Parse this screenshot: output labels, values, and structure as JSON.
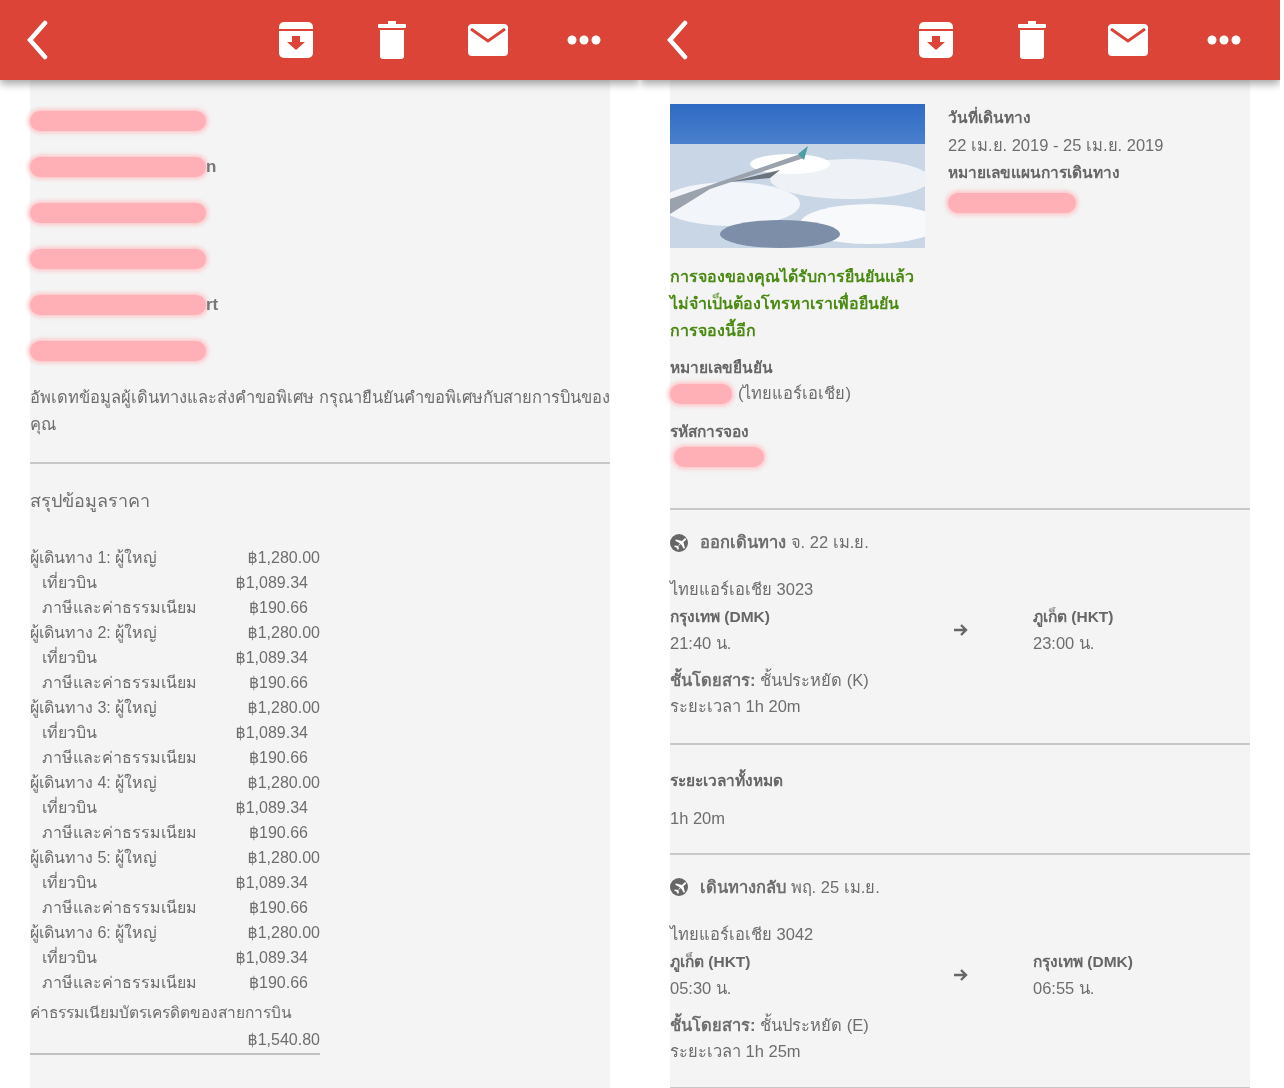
{
  "screens": [
    {
      "kind": "price",
      "names": [
        {
          "kind": "redacted"
        },
        {
          "kind": "redacted",
          "fragment": "n"
        },
        {
          "kind": "redacted"
        },
        {
          "kind": "redacted"
        },
        {
          "kind": "redacted",
          "fragment": "rt"
        },
        {
          "kind": "redacted"
        }
      ],
      "notice": "อัพเดทข้อมูลผู้เดินทางและส่งคำขอพิเศษ กรุณายืนยันคำขอพิเศษกับสายการบินของคุณ",
      "price_title": "สรุปข้อมูลราคา",
      "passengers": [
        {
          "label": "ผู้เดินทาง 1: ผู้ใหญ่",
          "total": "฿1,280.00",
          "items": [
            {
              "label": "เที่ยวบิน",
              "amount": "฿1,089.34"
            },
            {
              "label": "ภาษีและค่าธรรมเนียม",
              "amount": "฿190.66"
            }
          ]
        },
        {
          "label": "ผู้เดินทาง 2: ผู้ใหญ่",
          "total": "฿1,280.00",
          "items": [
            {
              "label": "เที่ยวบิน",
              "amount": "฿1,089.34"
            },
            {
              "label": "ภาษีและค่าธรรมเนียม",
              "amount": "฿190.66"
            }
          ]
        },
        {
          "label": "ผู้เดินทาง 3: ผู้ใหญ่",
          "total": "฿1,280.00",
          "items": [
            {
              "label": "เที่ยวบิน",
              "amount": "฿1,089.34"
            },
            {
              "label": "ภาษีและค่าธรรมเนียม",
              "amount": "฿190.66"
            }
          ]
        },
        {
          "label": "ผู้เดินทาง 4: ผู้ใหญ่",
          "total": "฿1,280.00",
          "items": [
            {
              "label": "เที่ยวบิน",
              "amount": "฿1,089.34"
            },
            {
              "label": "ภาษีและค่าธรรมเนียม",
              "amount": "฿190.66"
            }
          ]
        },
        {
          "label": "ผู้เดินทาง 5: ผู้ใหญ่",
          "total": "฿1,280.00",
          "items": [
            {
              "label": "เที่ยวบิน",
              "amount": "฿1,089.34"
            },
            {
              "label": "ภาษีและค่าธรรมเนียม",
              "amount": "฿190.66"
            }
          ]
        },
        {
          "label": "ผู้เดินทาง 6: ผู้ใหญ่",
          "total": "฿1,280.00",
          "items": [
            {
              "label": "เที่ยวบิน",
              "amount": "฿1,089.34"
            },
            {
              "label": "ภาษีและค่าธรรมเนียม",
              "amount": "฿190.66"
            }
          ]
        }
      ],
      "card_fee": {
        "label": "ค่าธรรมเนียมบัตรเครดิตของสายการบิน",
        "amount": "฿1,540.80"
      }
    },
    {
      "kind": "itinerary",
      "trip_dates_label": "วันที่เดินทาง",
      "trip_dates": "22 เม.ย. 2019 - 25 เม.ย. 2019",
      "itinerary_label": "หมายเลขแผนการเดินทาง",
      "itinerary_number": {
        "kind": "redacted"
      },
      "confirmation_message": "การจองของคุณได้รับการยืนยันแล้ว ไม่จำเป็นต้องโทรหาเราเพื่อยืนยันการจองนี้อีก",
      "confirmation_label": "หมายเลขยืนยัน",
      "confirmation_number": {
        "kind": "redacted",
        "suffix": "(ไทยแอร์เอเชีย)"
      },
      "booking_code_label": "รหัสการจอง",
      "booking_code": {
        "kind": "redacted"
      },
      "flights": [
        {
          "heading": "**ออกเดินทาง** จ. 22 เม.ย.",
          "flight": "ไทยแอร์เอเชีย 3023",
          "from": "กรุงเทพ (DMK)",
          "from_time": "21:40 น.",
          "to": "ภูเก็ต (HKT)",
          "to_time": "23:00 น.",
          "cabin": "**ชั้นโดยสาร:** ชั้นประหยัด (K)",
          "duration": "ระยะเวลา 1h 20m"
        },
        {
          "heading": "**เดินทางกลับ** พฤ. 25 เม.ย.",
          "flight": "ไทยแอร์เอเชีย 3042",
          "from": "ภูเก็ต (HKT)",
          "from_time": "05:30 น.",
          "to": "กรุงเทพ (DMK)",
          "to_time": "06:55 น.",
          "cabin": "**ชั้นโดยสาร:** ชั้นประหยัด (E)",
          "duration": "ระยะเวลา 1h 25m"
        }
      ],
      "total_duration_label": "ระยะเวลาทั้งหมด",
      "total_duration": "1h 20m"
    }
  ]
}
